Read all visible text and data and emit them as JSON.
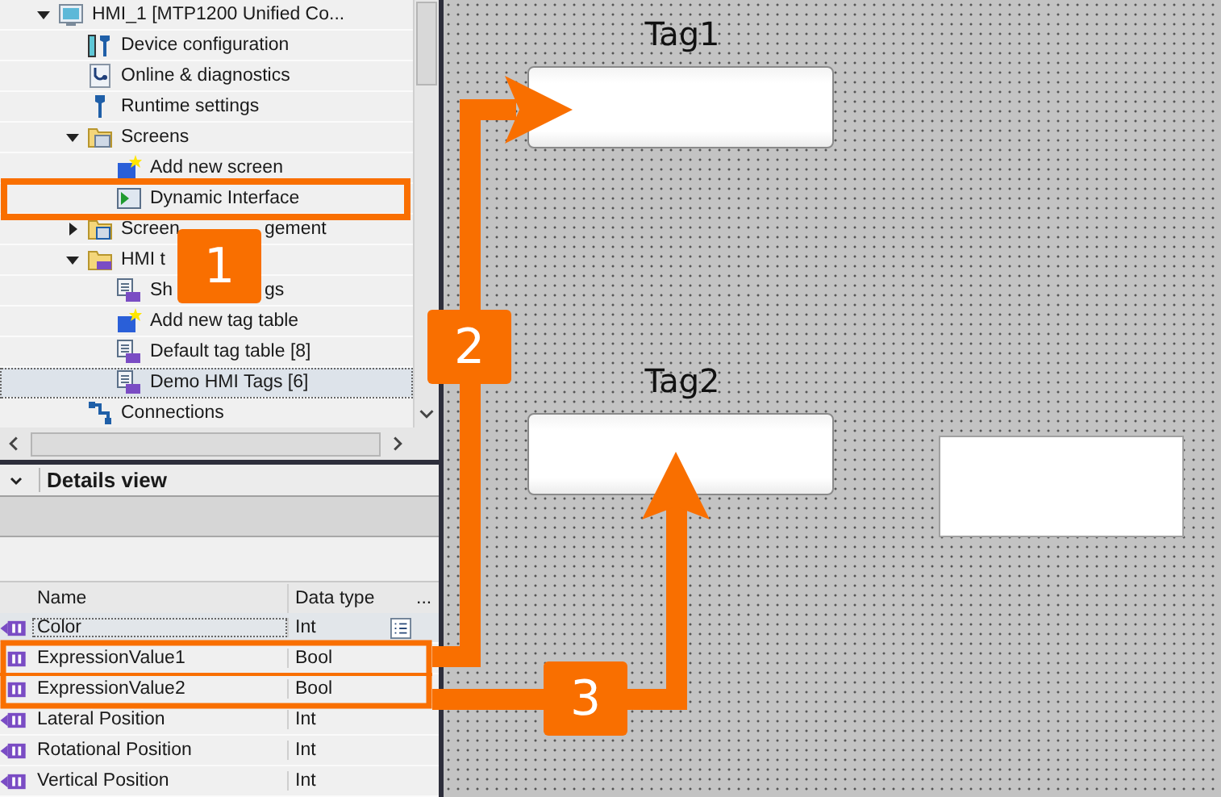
{
  "tree": [
    {
      "label": "HMI_1 [MTP1200 Unified Co...",
      "kind": "device",
      "expanded": true,
      "selected": false,
      "children": [
        {
          "label": "Device configuration",
          "kind": "config",
          "selected": false
        },
        {
          "label": "Online & diagnostics",
          "kind": "diagnostics",
          "selected": false
        },
        {
          "label": "Runtime settings",
          "kind": "settings",
          "selected": false
        },
        {
          "label": "Screens",
          "kind": "folder",
          "expanded": true,
          "selected": false,
          "children": [
            {
              "label": "Add new screen",
              "kind": "add",
              "selected": false
            },
            {
              "label": "Dynamic Interface",
              "kind": "screen",
              "selected": false
            }
          ]
        },
        {
          "label": "Screen",
          "label_after": "gement",
          "kind": "screen-folder",
          "expanded": false,
          "selected": false
        },
        {
          "label": "HMI t",
          "kind": "tag-folder",
          "expanded": true,
          "selected": false,
          "children": [
            {
              "label": "Sh",
              "label_after": "gs",
              "kind": "tag-table",
              "selected": false
            },
            {
              "label": "Add new tag table",
              "kind": "add",
              "selected": false
            },
            {
              "label": "Default tag table [8]",
              "kind": "tag-table",
              "selected": false
            },
            {
              "label": "Demo HMI Tags [6]",
              "kind": "tag-table",
              "selected": true
            }
          ]
        },
        {
          "label": "Connections",
          "kind": "connections",
          "selected": false
        }
      ]
    }
  ],
  "details_view": {
    "title": "Details view",
    "columns": [
      "Name",
      "Data type",
      "..."
    ],
    "rows": [
      {
        "name": "Color",
        "data_type": "Int",
        "kind": "inout",
        "selected": true,
        "list_button": true
      },
      {
        "name": "ExpressionValue1",
        "data_type": "Bool",
        "kind": "in",
        "selected": false,
        "list_button": false
      },
      {
        "name": "ExpressionValue2",
        "data_type": "Bool",
        "kind": "in",
        "selected": false,
        "list_button": false
      },
      {
        "name": "Lateral Position",
        "data_type": "Int",
        "kind": "inout",
        "selected": false,
        "list_button": false
      },
      {
        "name": "Rotational Position",
        "data_type": "Int",
        "kind": "inout",
        "selected": false,
        "list_button": false
      },
      {
        "name": "Vertical Position",
        "data_type": "Int",
        "kind": "inout",
        "selected": false,
        "list_button": false
      }
    ]
  },
  "screen_objects": [
    {
      "kind": "io-field",
      "label": "Tag1"
    },
    {
      "kind": "io-field",
      "label": "Tag2"
    },
    {
      "kind": "rectangle"
    }
  ],
  "callouts": [
    {
      "number": "1"
    },
    {
      "number": "2"
    },
    {
      "number": "3"
    }
  ]
}
